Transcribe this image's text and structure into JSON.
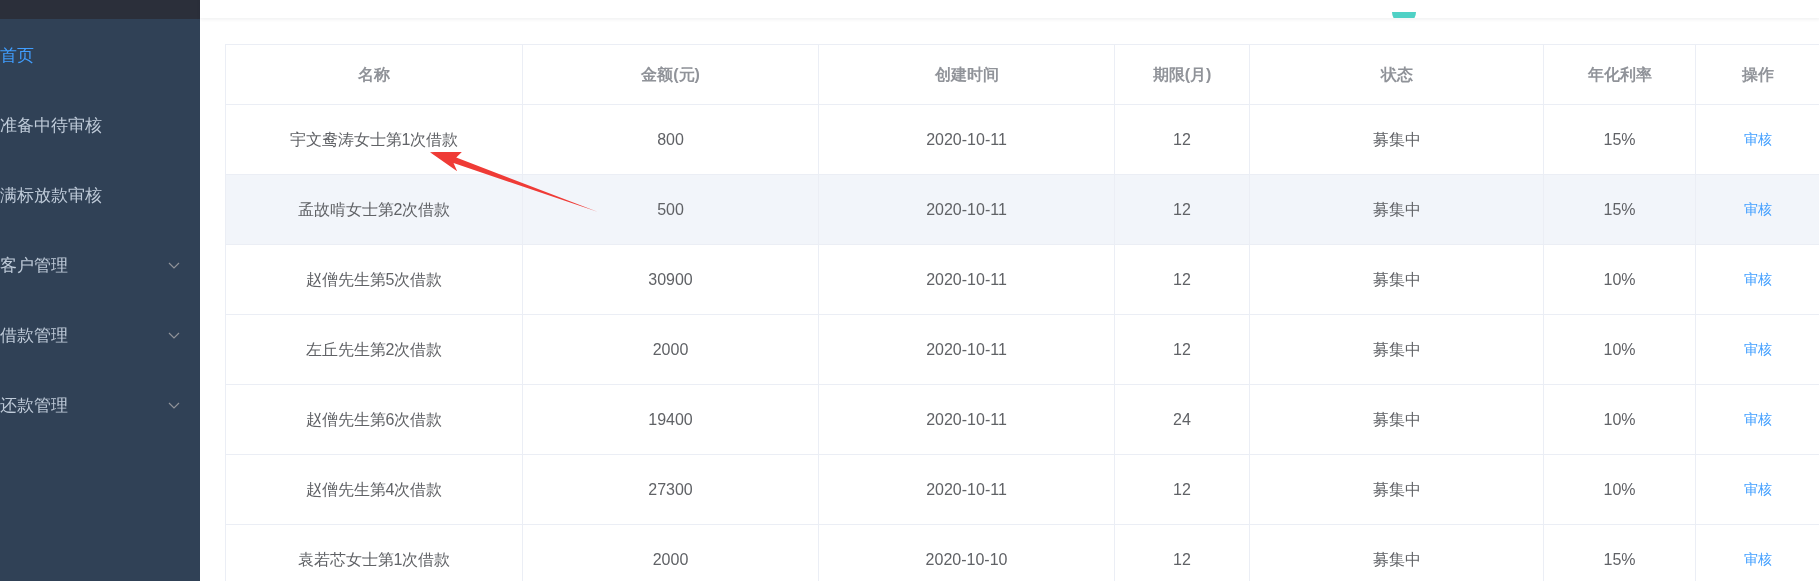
{
  "sidebar": {
    "items": [
      {
        "label": "首页",
        "kind": "link",
        "selected": true
      },
      {
        "label": "准备中待审核",
        "kind": "link",
        "selected": false
      },
      {
        "label": "满标放款审核",
        "kind": "link",
        "selected": false
      },
      {
        "label": "客户管理",
        "kind": "submenu",
        "selected": false,
        "expanded": false
      },
      {
        "label": "借款管理",
        "kind": "submenu",
        "selected": false,
        "expanded": false
      },
      {
        "label": "还款管理",
        "kind": "submenu",
        "selected": false,
        "expanded": false
      }
    ]
  },
  "table": {
    "columns": [
      "名称",
      "金额(元)",
      "创建时间",
      "期限(月)",
      "状态",
      "年化利率",
      "操作"
    ],
    "rows": [
      {
        "name": "宇文鸯涛女士第1次借款",
        "amount": "800",
        "created": "2020-10-11",
        "term": "12",
        "status": "募集中",
        "rate": "15%",
        "action": "审核",
        "highlighted": false
      },
      {
        "name": "孟故啃女士第2次借款",
        "amount": "500",
        "created": "2020-10-11",
        "term": "12",
        "status": "募集中",
        "rate": "15%",
        "action": "审核",
        "highlighted": true
      },
      {
        "name": "赵僧先生第5次借款",
        "amount": "30900",
        "created": "2020-10-11",
        "term": "12",
        "status": "募集中",
        "rate": "10%",
        "action": "审核",
        "highlighted": false
      },
      {
        "name": "左丘先生第2次借款",
        "amount": "2000",
        "created": "2020-10-11",
        "term": "12",
        "status": "募集中",
        "rate": "10%",
        "action": "审核",
        "highlighted": false
      },
      {
        "name": "赵僧先生第6次借款",
        "amount": "19400",
        "created": "2020-10-11",
        "term": "24",
        "status": "募集中",
        "rate": "10%",
        "action": "审核",
        "highlighted": false
      },
      {
        "name": "赵僧先生第4次借款",
        "amount": "27300",
        "created": "2020-10-11",
        "term": "12",
        "status": "募集中",
        "rate": "10%",
        "action": "审核",
        "highlighted": false
      },
      {
        "name": "袁若芯女士第1次借款",
        "amount": "2000",
        "created": "2020-10-10",
        "term": "12",
        "status": "募集中",
        "rate": "15%",
        "action": "审核",
        "highlighted": false
      }
    ]
  }
}
